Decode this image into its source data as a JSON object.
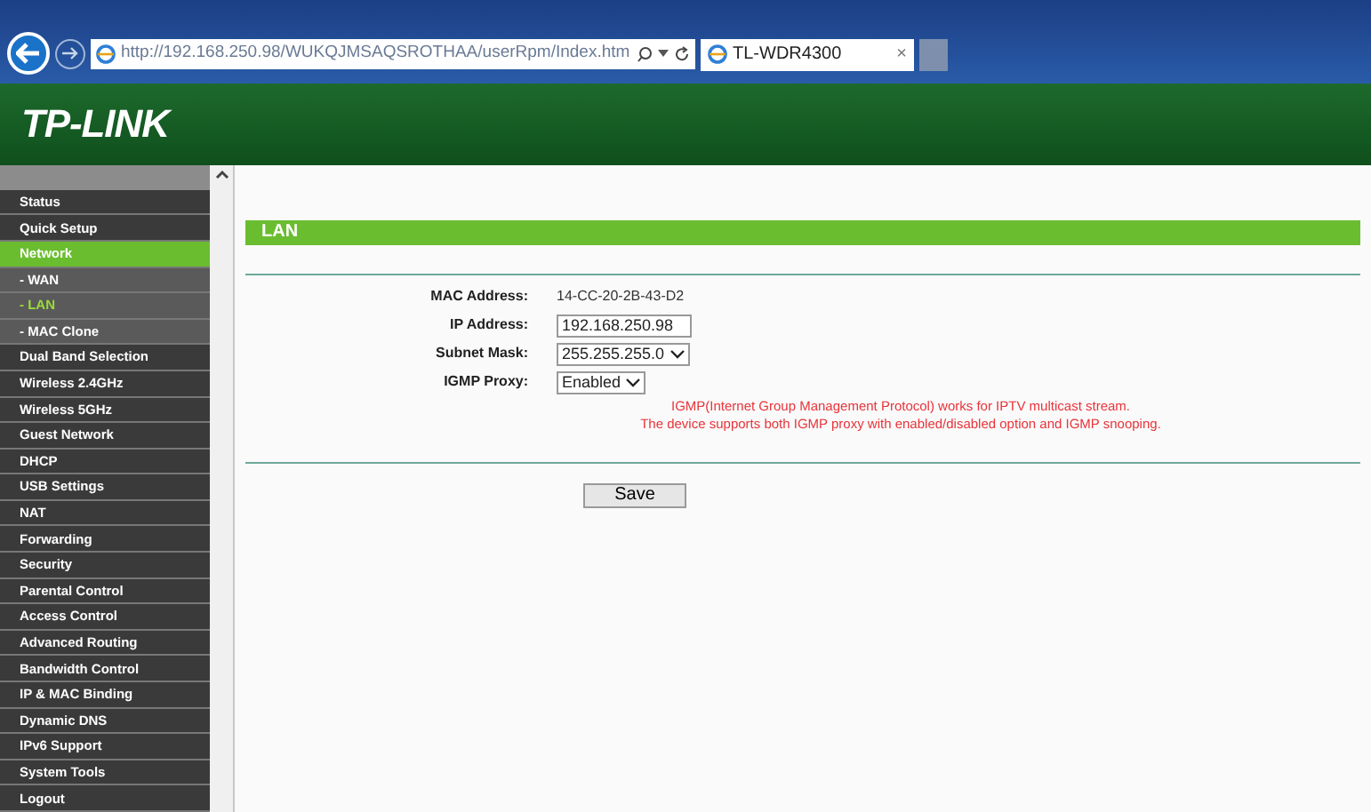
{
  "browser": {
    "address": "http://192.168.250.98/WUKQJMSAQSROTHAA/userRpm/Index.htm",
    "tab": {
      "title": "TL-WDR4300",
      "close": "×"
    }
  },
  "header": {
    "logo": "TP-LINK"
  },
  "sidebar": {
    "items": [
      {
        "label": "Status",
        "selected": false
      },
      {
        "label": "Quick Setup",
        "selected": false
      },
      {
        "label": "Network",
        "selected": true,
        "expanded": true,
        "children": [
          {
            "label": "- WAN",
            "selected": false
          },
          {
            "label": "- LAN",
            "selected": true
          },
          {
            "label": "- MAC Clone",
            "selected": false
          }
        ]
      },
      {
        "label": "Dual Band Selection",
        "selected": false
      },
      {
        "label": "Wireless 2.4GHz",
        "selected": false
      },
      {
        "label": "Wireless 5GHz",
        "selected": false
      },
      {
        "label": "Guest Network",
        "selected": false
      },
      {
        "label": "DHCP",
        "selected": false
      },
      {
        "label": "USB Settings",
        "selected": false
      },
      {
        "label": "NAT",
        "selected": false
      },
      {
        "label": "Forwarding",
        "selected": false
      },
      {
        "label": "Security",
        "selected": false
      },
      {
        "label": "Parental Control",
        "selected": false
      },
      {
        "label": "Access Control",
        "selected": false
      },
      {
        "label": "Advanced Routing",
        "selected": false
      },
      {
        "label": "Bandwidth Control",
        "selected": false
      },
      {
        "label": "IP & MAC Binding",
        "selected": false
      },
      {
        "label": "Dynamic DNS",
        "selected": false
      },
      {
        "label": "IPv6 Support",
        "selected": false
      },
      {
        "label": "System Tools",
        "selected": false
      },
      {
        "label": "Logout",
        "selected": false
      }
    ]
  },
  "panel": {
    "title": "LAN",
    "fields": [
      {
        "kind": "text",
        "label": "MAC Address:",
        "value": "14-CC-20-2B-43-D2"
      },
      {
        "kind": "input",
        "label": "IP Address:",
        "value": "192.168.250.98"
      },
      {
        "kind": "select",
        "label": "Subnet Mask:",
        "value": "255.255.255.0"
      },
      {
        "kind": "select",
        "label": "IGMP Proxy:",
        "value": "Enabled"
      }
    ],
    "notes": [
      "IGMP(Internet Group Management Protocol) works for IPTV multicast stream.",
      "The device supports both IGMP proxy with enabled/disabled option and IGMP snooping."
    ],
    "save": "Save"
  }
}
